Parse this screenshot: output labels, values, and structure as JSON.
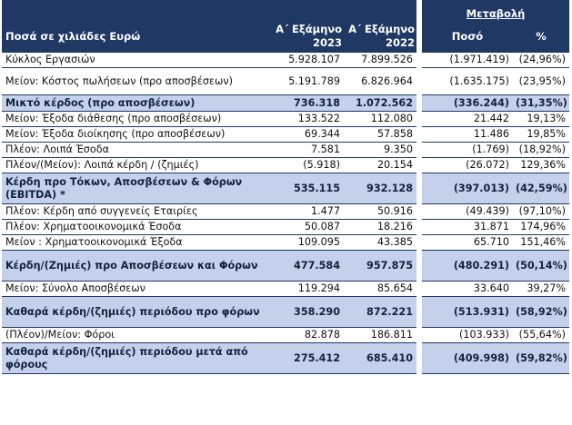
{
  "header": {
    "label": "Ποσά σε χιλιάδες Ευρώ",
    "col1": "Α΄ Εξάμηνο 2023",
    "col1a": "Α΄ Εξάμηνο",
    "col1b": "2023",
    "col2a": "Α΄ Εξάμηνο",
    "col2b": "2022",
    "change_group": "Μεταβολή",
    "change_amount": "Ποσό",
    "change_pct": "%"
  },
  "rows": [
    {
      "label": "Κύκλος Εργασιών",
      "v2023": "5.928.107",
      "v2022": "7.899.526",
      "amount": "(1.971.419)",
      "pct": "(24,96%)"
    },
    {
      "label": "Μείον: Κόστος πωλήσεων (προ αποσβέσεων)",
      "v2023": "5.191.789",
      "v2022": "6.826.964",
      "amount": "(1.635.175)",
      "pct": "(23,95%)"
    },
    {
      "label": "Μικτό κέρδος (προ αποσβέσεων)",
      "v2023": "736.318",
      "v2022": "1.072.562",
      "amount": "(336.244)",
      "pct": "(31,35%)"
    },
    {
      "label": "Μείον: Έξοδα διάθεσης (προ αποσβέσεων)",
      "v2023": "133.522",
      "v2022": "112.080",
      "amount": "21.442",
      "pct": "19,13%"
    },
    {
      "label": "Μείον: Έξοδα διοίκησης (προ αποσβέσεων)",
      "v2023": "69.344",
      "v2022": "57.858",
      "amount": "11.486",
      "pct": "19,85%"
    },
    {
      "label": "Πλέον: Λοιπά Έσοδα",
      "v2023": "7.581",
      "v2022": "9.350",
      "amount": "(1.769)",
      "pct": "(18,92%)"
    },
    {
      "label": "Πλέον/(Μείον): Λοιπά κέρδη / (ζημιές)",
      "v2023": "(5.918)",
      "v2022": "20.154",
      "amount": "(26.072)",
      "pct": "129,36%"
    },
    {
      "label": "Κέρδη προ Τόκων, Αποσβέσεων & Φόρων (EBITDA) *",
      "v2023": "535.115",
      "v2022": "932.128",
      "amount": "(397.013)",
      "pct": "(42,59%)"
    },
    {
      "label": "Πλέον: Κέρδη από συγγενείς Εταιρίες",
      "v2023": "1.477",
      "v2022": "50.916",
      "amount": "(49.439)",
      "pct": "(97,10%)"
    },
    {
      "label": "Πλέον: Χρηματοοικονομικά Έσοδα",
      "v2023": "50.087",
      "v2022": "18.216",
      "amount": "31.871",
      "pct": "174,96%"
    },
    {
      "label": "Μείον : Χρηματοοικονομικά Έξοδα",
      "v2023": "109.095",
      "v2022": "43.385",
      "amount": "65.710",
      "pct": "151,46%"
    },
    {
      "label": "Κέρδη/(Ζημιές) προ Αποσβέσεων και Φόρων",
      "v2023": "477.584",
      "v2022": "957.875",
      "amount": "(480.291)",
      "pct": "(50,14%)"
    },
    {
      "label": "Μείον: Σύνολο Αποσβέσεων",
      "v2023": "119.294",
      "v2022": "85.654",
      "amount": "33.640",
      "pct": "39,27%"
    },
    {
      "label": "Καθαρά κέρδη/(ζημιές) περιόδου προ φόρων",
      "v2023": "358.290",
      "v2022": "872.221",
      "amount": "(513.931)",
      "pct": "(58,92%)"
    },
    {
      "label": "(Πλέον)/Μείον: Φόροι",
      "v2023": "82.878",
      "v2022": "186.811",
      "amount": "(103.933)",
      "pct": "(55,64%)"
    },
    {
      "label": "Καθαρά κέρδη/(ζημιές) περιόδου μετά από φόρους",
      "v2023": "275.412",
      "v2022": "685.410",
      "amount": "(409.998)",
      "pct": "(59,82%)"
    }
  ],
  "colors": {
    "header_bg": "#1f3864",
    "subtotal_bg": "#c5d0ea"
  }
}
